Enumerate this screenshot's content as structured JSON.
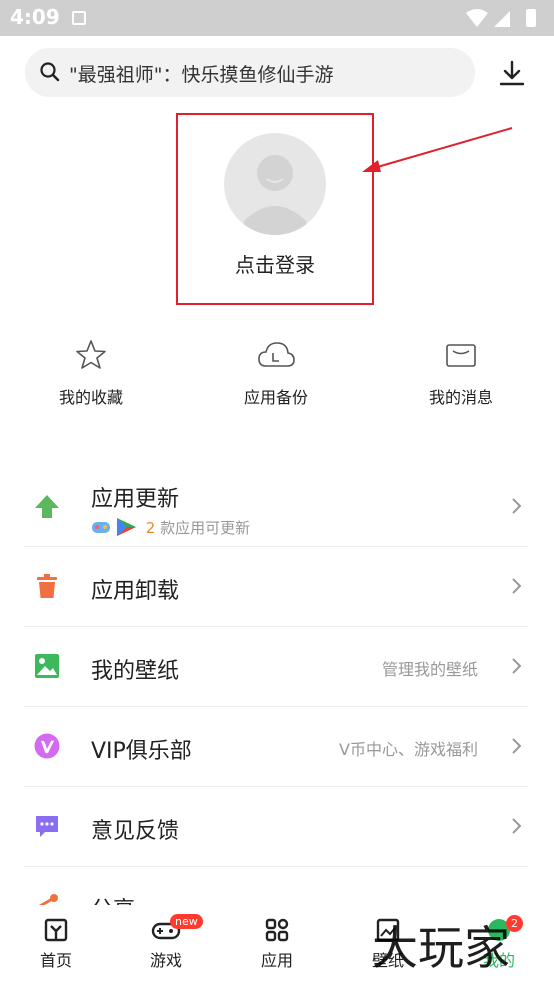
{
  "status_bar": {
    "time": "4:09"
  },
  "search": {
    "placeholder": "\"最强祖师\"：快乐摸鱼修仙手游"
  },
  "profile": {
    "login_label": "点击登录"
  },
  "quick_actions": [
    {
      "label": "我的收藏",
      "icon": "star-icon"
    },
    {
      "label": "应用备份",
      "icon": "cloud-icon"
    },
    {
      "label": "我的消息",
      "icon": "mail-icon"
    }
  ],
  "menu": {
    "update": {
      "title": "应用更新",
      "count": "2",
      "subtitle": " 款应用可更新",
      "icon": "upload-arrow-icon",
      "color": "#5cb85c"
    },
    "uninstall": {
      "title": "应用卸载",
      "icon": "trash-icon",
      "color": "#f07040"
    },
    "wallpaper": {
      "title": "我的壁纸",
      "subtitle": "管理我的壁纸",
      "icon": "image-icon",
      "color": "#3db85a"
    },
    "vip": {
      "title": "VIP俱乐部",
      "subtitle": "V币中心、游戏福利",
      "icon": "vip-icon",
      "color": "#d46af0"
    },
    "feedback": {
      "title": "意见反馈",
      "icon": "feedback-icon",
      "color": "#8a6df0"
    },
    "share": {
      "title": "分享"
    }
  },
  "bottom_nav": [
    {
      "label": "首页",
      "icon": "home-icon"
    },
    {
      "label": "游戏",
      "icon": "gamepad-icon",
      "badge": "new"
    },
    {
      "label": "应用",
      "icon": "apps-icon"
    },
    {
      "label": "壁纸",
      "icon": "wallpaper-icon"
    },
    {
      "label": "我的",
      "icon": "profile-icon",
      "badge": "2"
    }
  ],
  "watermark": "大玩家",
  "colors": {
    "accent_red": "#e0202a",
    "update_orange": "#f08a2c",
    "active_green": "#2cb85c"
  }
}
